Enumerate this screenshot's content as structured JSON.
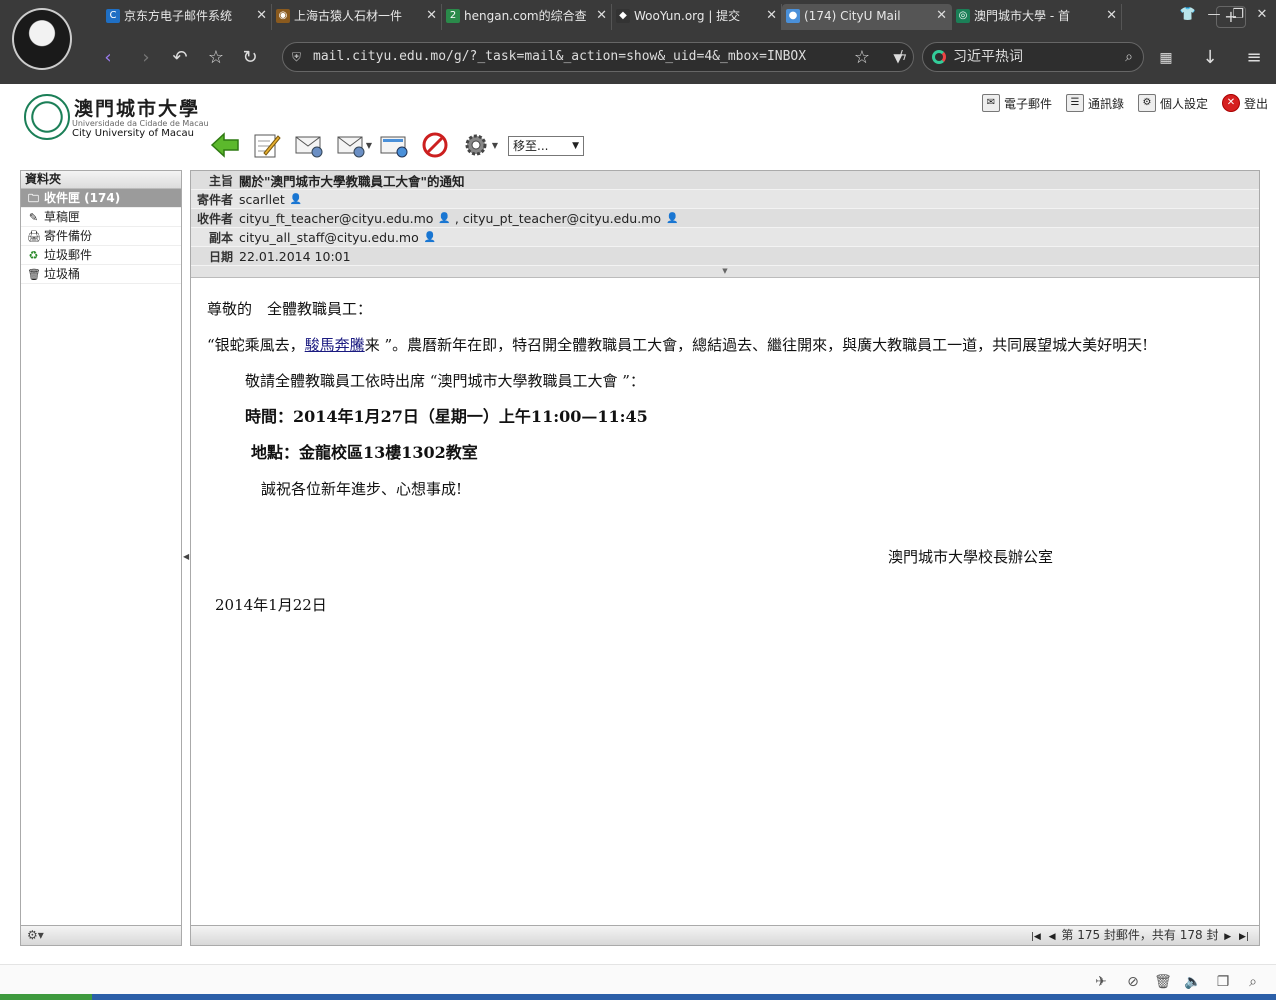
{
  "browser": {
    "tabs": [
      {
        "label": "京东方电子邮件系统",
        "icon": "C",
        "icon_color": "#1f6fc4"
      },
      {
        "label": "上海古猿人石材一件",
        "icon": "◉",
        "icon_color": "#8a5a1e"
      },
      {
        "label": "hengan.com的综合查",
        "icon": "2",
        "icon_color": "#2a8a4a"
      },
      {
        "label": "WooYun.org | 提交",
        "icon": "◆",
        "icon_color": "#333333"
      },
      {
        "label": "(174) CityU Mail",
        "icon": "●",
        "icon_color": "#4a90d9"
      },
      {
        "label": "澳門城市大學 - 首",
        "icon": "◎",
        "icon_color": "#1b7f57"
      }
    ],
    "active_tab": 4,
    "url": "mail.cityu.edu.mo/g/?_task=mail&_action=show&_uid=4&_mbox=INBOX",
    "search_text": "习近平热词"
  },
  "app": {
    "logo_zh": "澳門城市大學",
    "logo_pt": "Universidade da Cidade de Macau",
    "logo_en": "City University of Macau",
    "topnav": {
      "mail": "電子郵件",
      "addressbook": "通訊錄",
      "settings": "個人設定",
      "logout": "登出"
    },
    "move_to_label": "移至..."
  },
  "sidebar": {
    "title": "資料夾",
    "folders": [
      {
        "label": "收件匣 (174)",
        "icon": "inbox-icon"
      },
      {
        "label": "草稿匣",
        "icon": "pencil-icon"
      },
      {
        "label": "寄件備份",
        "icon": "sent-icon"
      },
      {
        "label": "垃圾郵件",
        "icon": "junk-icon"
      },
      {
        "label": "垃圾桶",
        "icon": "trash-icon"
      }
    ],
    "footer_icon": "⚙▾"
  },
  "message": {
    "labels": {
      "subject": "主旨",
      "from": "寄件者",
      "to": "收件者",
      "cc": "副本",
      "date": "日期"
    },
    "subject": "關於\"澳門城市大學教職員工大會\"的通知",
    "from": "scarllet",
    "to_1": "cityu_ft_teacher@cityu.edu.mo",
    "to_2": "cityu_pt_teacher@cityu.edu.mo",
    "cc": "cityu_all_staff@cityu.edu.mo",
    "date": "22.01.2014 10:01",
    "body": {
      "greeting": "尊敬的　全體教職員工：",
      "p1_a": "“银蛇乘風去，",
      "p1_link": "駿馬奔騰",
      "p1_b": "来 ”。農曆新年在即，特召開全體教職員工大會，總結過去、繼往開來，與廣大教職員工一道，共同展望城大美好明天!",
      "p2": "敬請全體教職員工依時出席 “澳門城市大學教職員工大會 ”：",
      "time": "時間：2014年1月27日（星期一）上午11:00—11:45",
      "place": "地點：金龍校區13樓1302教室",
      "wishes": "誠祝各位新年進步、心想事成!",
      "signature": "澳門城市大學校長辦公室",
      "sign_date": "2014年1月22日"
    },
    "pager": "第 175 封郵件，共有 178 封"
  }
}
